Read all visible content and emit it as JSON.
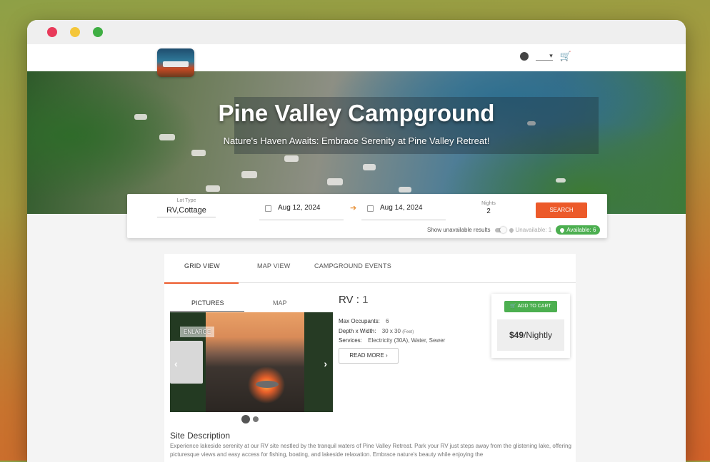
{
  "header": {
    "dropdown_value": "▾",
    "account_icon": "account-circle-icon",
    "cart_icon": "shopping-cart-icon"
  },
  "hero": {
    "title": "Pine Valley Campground",
    "subtitle": "Nature's Haven Awaits: Embrace Serenity at Pine Valley Retreat!"
  },
  "search": {
    "lot_type_label": "Lot Type",
    "lot_type_value": "RV,Cottage",
    "start_date": "Aug 12, 2024",
    "arrow": "➔",
    "end_date": "Aug 14, 2024",
    "nights_label": "Nights",
    "nights_value": "2",
    "search_button": "SEARCH",
    "show_unavailable_label": "Show unavailable results",
    "unavailable_badge": "Unavailable: 1",
    "available_badge": "Available: 6"
  },
  "tabs": [
    "GRID VIEW",
    "MAP VIEW",
    "CAMPGROUND EVENTS"
  ],
  "listing": {
    "media_tabs": [
      "PICTURES",
      "MAP"
    ],
    "enlarge_label": "ENLARGE",
    "prev_arrow": "‹",
    "next_arrow": "›",
    "title_prefix": "RV :",
    "title_number": "1",
    "max_occupants_label": "Max Occupants:",
    "max_occupants_value": "6",
    "depth_width_label": "Depth x Width:",
    "depth_width_value": "30 x 30",
    "depth_width_unit": "(Feet)",
    "services_label": "Services:",
    "services_value": "Electricity (30A), Water, Sewer",
    "read_more": "READ MORE",
    "read_more_chevron": "›",
    "add_to_cart": "ADD TO CART",
    "price": "$49",
    "price_unit": "/Nightly",
    "carousel_dots": 2
  },
  "description": {
    "title": "Site Description",
    "text": "Experience lakeside serenity at our RV site nestled by the tranquil waters of Pine Valley Retreat. Park your RV just steps away from the glistening lake, offering picturesque views and easy access for fishing, boating, and lakeside relaxation. Embrace nature's beauty while enjoying the"
  }
}
